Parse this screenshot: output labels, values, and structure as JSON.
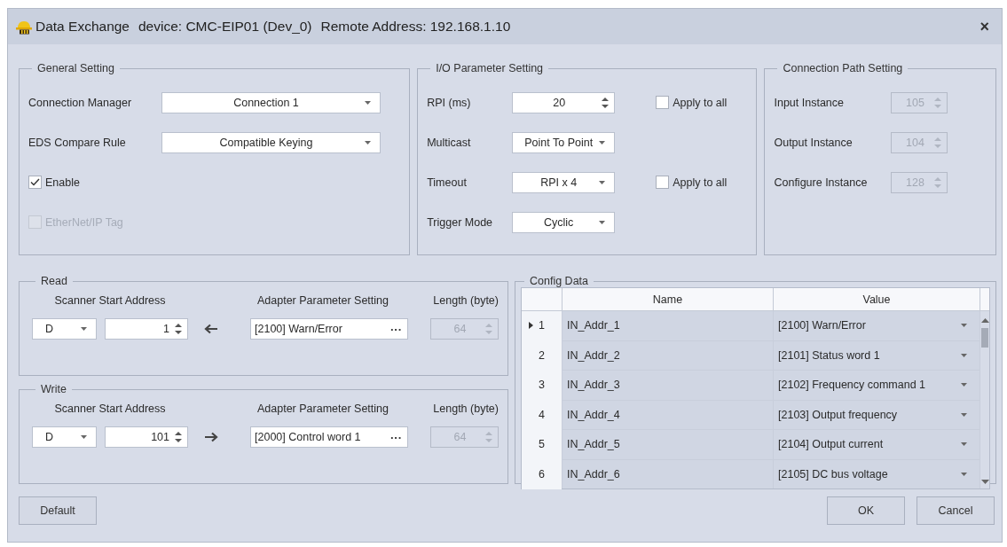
{
  "window": {
    "title_parts": [
      "Data Exchange",
      "device: CMC-EIP01 (Dev_0)",
      "Remote Address: 192.168.1.10"
    ],
    "close": "×"
  },
  "general": {
    "title": "General Setting",
    "fields": [
      {
        "label": "Connection Manager",
        "value": "Connection 1"
      },
      {
        "label": "EDS Compare Rule",
        "value": "Compatible Keying"
      }
    ],
    "checkboxes": [
      {
        "label": "Enable",
        "checked": true,
        "disabled": false
      },
      {
        "label": "EtherNet/IP Tag",
        "checked": false,
        "disabled": true
      }
    ]
  },
  "io": {
    "title": "I/O Parameter Setting",
    "rows": [
      {
        "label": "RPI (ms)",
        "kind": "spin",
        "value": "20",
        "apply": {
          "label": "Apply to all",
          "checked": false
        }
      },
      {
        "label": "Multicast",
        "kind": "combo",
        "value": "Point To Point"
      },
      {
        "label": "Timeout",
        "kind": "combo",
        "value": "RPI x 4",
        "apply": {
          "label": "Apply to all",
          "checked": false
        }
      },
      {
        "label": "Trigger Mode",
        "kind": "combo",
        "value": "Cyclic"
      }
    ]
  },
  "path": {
    "title": "Connection Path Setting",
    "rows": [
      {
        "label": "Input Instance",
        "value": "105",
        "disabled": true
      },
      {
        "label": "Output Instance",
        "value": "104",
        "disabled": true
      },
      {
        "label": "Configure Instance",
        "value": "128",
        "disabled": true
      }
    ]
  },
  "mappings": [
    {
      "title": "Read",
      "kind": "read",
      "headers": [
        "Scanner Start Address",
        "Adapter Parameter Setting",
        "Length (byte)"
      ],
      "device": "D",
      "address": "1",
      "parameter": "[2100] Warn/Error",
      "more": "···",
      "length": {
        "value": "64",
        "disabled": true
      }
    },
    {
      "title": "Write",
      "kind": "write",
      "headers": [
        "Scanner Start Address",
        "Adapter Parameter Setting",
        "Length (byte)"
      ],
      "device": "D",
      "address": "101",
      "parameter": "[2000] Control word 1",
      "more": "···",
      "length": {
        "value": "64",
        "disabled": true
      }
    }
  ],
  "config": {
    "title": "Config Data",
    "columns": [
      "Name",
      "Value"
    ],
    "rows": [
      {
        "index": "1",
        "name": "IN_Addr_1",
        "value": "[2100] Warn/Error",
        "current": true
      },
      {
        "index": "2",
        "name": "IN_Addr_2",
        "value": "[2101] Status word 1",
        "current": false
      },
      {
        "index": "3",
        "name": "IN_Addr_3",
        "value": "[2102] Frequency command 1",
        "current": false
      },
      {
        "index": "4",
        "name": "IN_Addr_4",
        "value": "[2103] Output frequency",
        "current": false
      },
      {
        "index": "5",
        "name": "IN_Addr_5",
        "value": "[2104] Output current",
        "current": false
      },
      {
        "index": "6",
        "name": "IN_Addr_6",
        "value": "[2105] DC bus voltage",
        "current": false
      }
    ]
  },
  "buttons": {
    "left": [
      "Default"
    ],
    "right": [
      "OK",
      "Cancel"
    ]
  }
}
